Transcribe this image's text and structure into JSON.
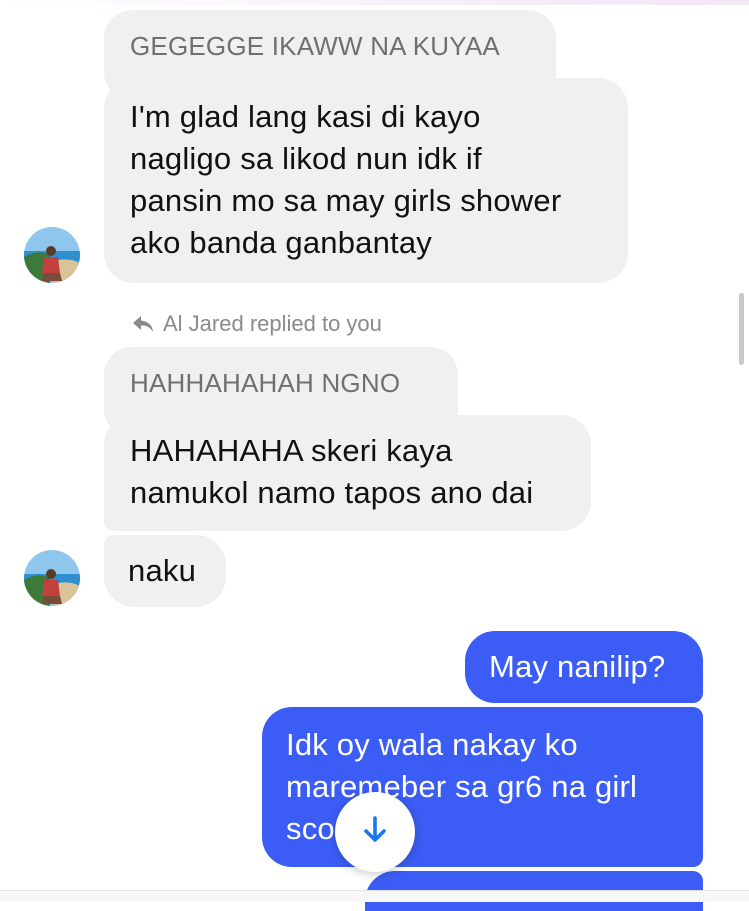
{
  "conversation": {
    "messages": [
      {
        "kind": "quoted",
        "sender": "contact",
        "text": "GEGEGGE IKAWW NA KUYAA"
      },
      {
        "kind": "incoming",
        "sender": "contact",
        "lines": [
          "I'm glad lang kasi di kayo",
          "nagligo sa likod nun idk if",
          "pansin mo sa may girls shower",
          "ako banda ganbantay"
        ]
      },
      {
        "kind": "reply_indicator",
        "text": "Al Jared replied to you"
      },
      {
        "kind": "quoted",
        "sender": "contact",
        "text": "HAHHAHAHAH NGNO"
      },
      {
        "kind": "incoming",
        "sender": "contact",
        "lines": [
          "HAHAHAHA skeri kaya",
          "namukol namo tapos ano dai"
        ]
      },
      {
        "kind": "incoming",
        "sender": "contact",
        "text": "naku"
      },
      {
        "kind": "outgoing",
        "sender": "me",
        "text": "May nanilip?"
      },
      {
        "kind": "outgoing",
        "sender": "me",
        "lines": [
          "Idk oy wala nakay ko",
          "maremeber sa gr6 na girl",
          "sco"
        ]
      }
    ]
  },
  "icons": {
    "reply": "reply-arrow-icon",
    "scroll_down": "arrow-down-icon",
    "avatar": "contact-avatar"
  },
  "colors": {
    "incoming_bubble": "#f0f0f0",
    "outgoing_bubble": "#3b5df5",
    "accent": "#1877f2",
    "muted_text": "#8a8a8a"
  }
}
